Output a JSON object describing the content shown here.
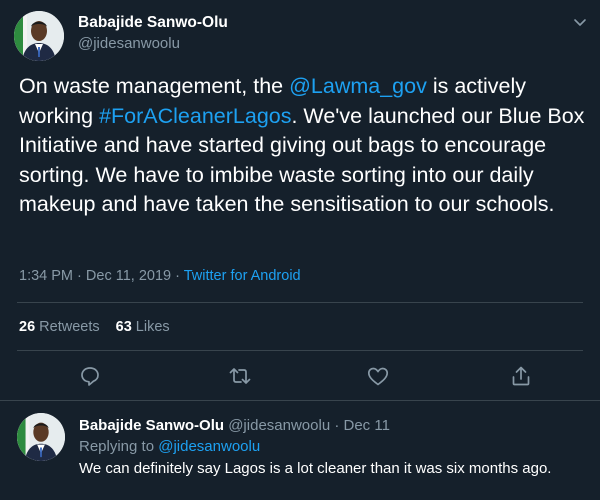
{
  "tweet": {
    "author_name": "Babajide Sanwo-Olu",
    "author_handle": "@jidesanwoolu",
    "text_parts": [
      "On waste management, the ",
      "@Lawma_gov",
      " is actively working ",
      "#ForACleanerLagos",
      ". We've launched our Blue Box Initiative and have started giving out bags to encourage sorting. We have to imbibe waste sorting into our daily makeup and have taken the sensitisation to our schools."
    ],
    "time": "1:34 PM",
    "date": "Dec 11, 2019",
    "separator": "·",
    "source": "Twitter for Android",
    "retweets_count": "26",
    "retweets_label": "Retweets",
    "likes_count": "63",
    "likes_label": "Likes",
    "icons": [
      "chevron-down-icon",
      "reply-icon",
      "retweet-icon",
      "like-icon",
      "share-icon"
    ]
  },
  "reply": {
    "author_name": "Babajide Sanwo-Olu",
    "author_handle": "@jidesanwoolu",
    "separator": "·",
    "date": "Dec 11",
    "replying_to_label": "Replying to",
    "replying_to_handle": "@jidesanwoolu",
    "text": "We can definitely say Lagos is a lot cleaner than it was six months ago."
  },
  "colors": {
    "background": "#15202b",
    "link": "#1da1f2",
    "secondary_text": "#8899a6",
    "divider": "#38444d"
  }
}
